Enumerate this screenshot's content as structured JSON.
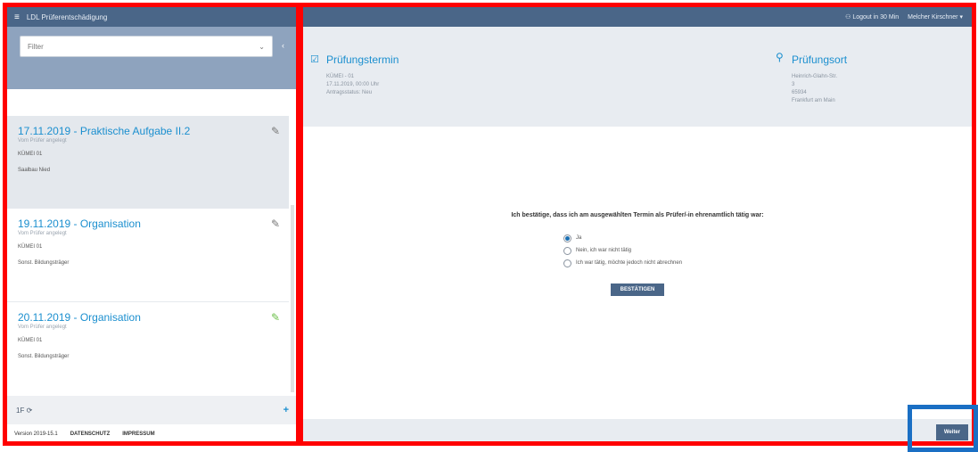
{
  "left": {
    "app_title": "LDL Prüferentschädigung",
    "filter": {
      "label": "Filter"
    },
    "cards": [
      {
        "title": "17.11.2019 - Praktische Aufgabe II.2",
        "sub": "Vom Prüfer angelegt",
        "line1": "KÜMEI 01",
        "line2": "Saalbau Nied"
      },
      {
        "title": "19.11.2019 - Organisation",
        "sub": "Vom Prüfer angelegt",
        "line1": "KÜMEI 01",
        "line2": "Sonst. Bildungsträger"
      },
      {
        "title": "20.11.2019 - Organisation",
        "sub": "Vom Prüfer angelegt",
        "line1": "KÜMEI 01",
        "line2": "Sonst. Bildungsträger"
      }
    ],
    "footer": {
      "count": "1F"
    },
    "version": "Version 2019-15.1",
    "datenschutz": "DATENSCHUTZ",
    "impressum": "IMPRESSUM"
  },
  "right": {
    "topbar": {
      "logout": "Logout in 30 Min",
      "user": "Melcher Kirschner"
    },
    "pruefungstermin": {
      "title": "Prüfungstermin",
      "lines": [
        "KÜMEI - 01",
        "17.11.2019, 00:00 Uhr",
        "Antragsstatus: Neu"
      ]
    },
    "pruefungsort": {
      "title": "Prüfungsort",
      "lines": [
        "Heinrich-Glahn-Str.",
        "3",
        "65934",
        "Frankfurt am Main"
      ]
    },
    "question": "Ich bestätige, dass ich am ausgewählten Termin als Prüfer/-in ehrenamtlich tätig war:",
    "options": [
      {
        "label": "Ja",
        "checked": true
      },
      {
        "label": "Nein, ich war nicht tätig",
        "checked": false
      },
      {
        "label": "Ich war tätig, möchte jedoch nicht abrechnen",
        "checked": false
      }
    ],
    "confirm_label": "BESTÄTIGEN",
    "weiter_label": "Weiter"
  },
  "icons": {
    "menu": "menu-icon",
    "calendar": "calendar-check-icon",
    "location": "map-pin-icon",
    "edit": "edit-icon",
    "refresh": "refresh-icon",
    "add": "plus-icon",
    "user": "user-icon"
  },
  "colors": {
    "accent": "#1b8fcf",
    "header": "#4a6688",
    "annotation_red": "#ff0000",
    "annotation_blue": "#1a6fc4",
    "edit_green": "#6cc04a"
  }
}
